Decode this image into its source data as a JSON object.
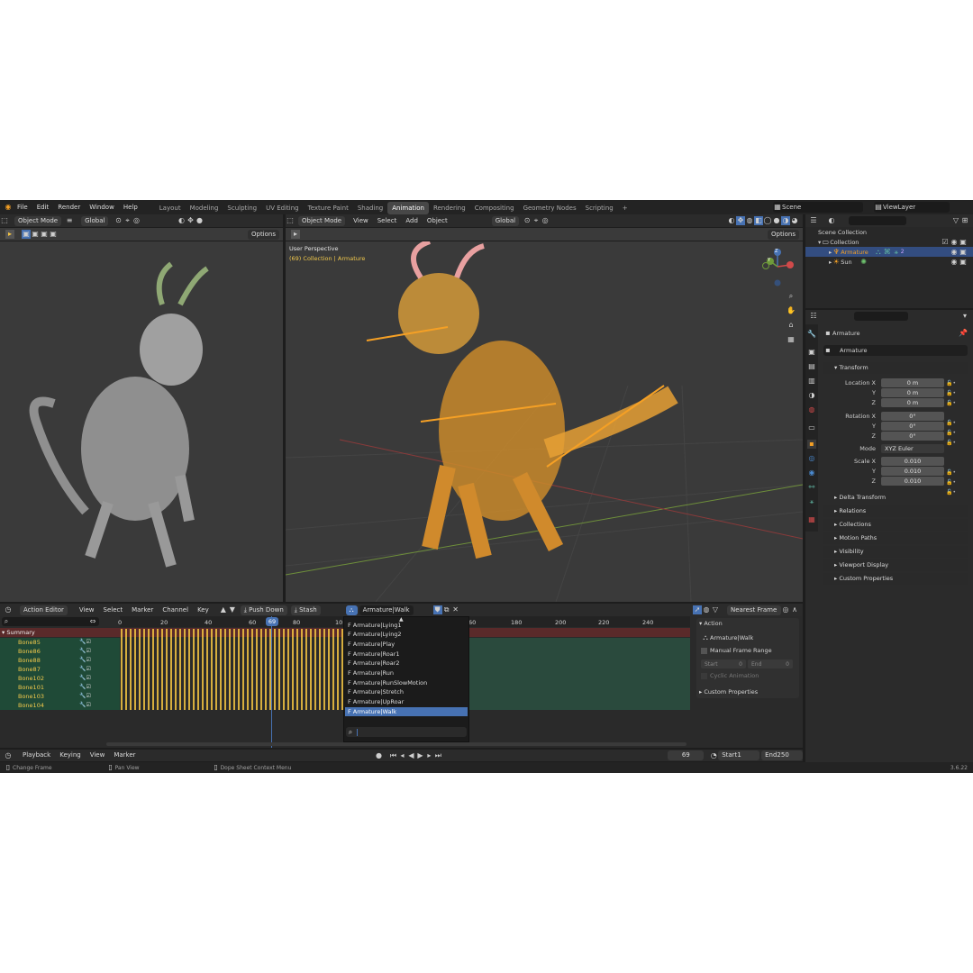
{
  "app": {
    "menu": [
      "File",
      "Edit",
      "Render",
      "Window",
      "Help"
    ],
    "workspaces": [
      "Layout",
      "Modeling",
      "Sculpting",
      "UV Editing",
      "Texture Paint",
      "Shading",
      "Animation",
      "Rendering",
      "Compositing",
      "Geometry Nodes",
      "Scripting"
    ],
    "active_workspace": "Animation",
    "add_tab": "+",
    "scene": "Scene",
    "view_layer": "ViewLayer",
    "version": "3.6.22"
  },
  "left_viewport": {
    "mode": "Object Mode",
    "orientation": "Global",
    "options": "Options"
  },
  "main_viewport": {
    "mode": "Object Mode",
    "menus": [
      "View",
      "Select",
      "Add",
      "Object"
    ],
    "orientation": "Global",
    "options": "Options",
    "perspective": "User Perspective",
    "context": "(69) Collection | Armature",
    "axes": {
      "z": "Z",
      "y": "Y"
    }
  },
  "outliner": {
    "root": "Scene Collection",
    "collection": "Collection",
    "items": [
      {
        "name": "Armature",
        "badge": "2"
      },
      {
        "name": "Sun"
      }
    ]
  },
  "properties": {
    "object_name": "Armature",
    "data_name": "Armature",
    "transform_header": "Transform",
    "location_label": "Location X",
    "y_label": "Y",
    "z_label": "Z",
    "location": [
      "0 m",
      "0 m",
      "0 m"
    ],
    "rotation_label": "Rotation X",
    "rotation": [
      "0°",
      "0°",
      "0°"
    ],
    "mode_label": "Mode",
    "mode_value": "XYZ Euler",
    "scale_label": "Scale X",
    "scale": [
      "0.010",
      "0.010",
      "0.010"
    ],
    "delta": "Delta Transform",
    "sections": [
      "Relations",
      "Collections",
      "Motion Paths",
      "Visibility",
      "Viewport Display",
      "Custom Properties"
    ]
  },
  "dopesheet": {
    "editor": "Action Editor",
    "menus": [
      "View",
      "Select",
      "Marker",
      "Channel",
      "Key"
    ],
    "push_down": "Push Down",
    "stash": "Stash",
    "action": "Armature|Walk",
    "snap": "Nearest Frame",
    "frame_ticks_left": [
      "0",
      "20",
      "40",
      "60",
      "80",
      "10"
    ],
    "frame_ticks_right": [
      "60",
      "180",
      "200",
      "220",
      "240"
    ],
    "current_frame": "69",
    "summary": "Summary",
    "channels": [
      "Bone85",
      "Bone86",
      "Bone88",
      "Bone87",
      "Bone102",
      "Bone101",
      "Bone103",
      "Bone104"
    ],
    "actions_list": [
      "F Armature|Lying1",
      "F Armature|Lying2",
      "F Armature|Play",
      "F Armature|Roar1",
      "F Armature|Roar2",
      "F Armature|Run",
      "F Armature|RunSlowMotion",
      "F Armature|Stretch",
      "F Armature|UpRoar",
      "F Armature|Walk"
    ],
    "side_panel": {
      "action_header": "Action",
      "action_name": "Armature|Walk",
      "manual_range": "Manual Frame Range",
      "start_label": "Start",
      "start_value": "0",
      "end_label": "End",
      "end_value": "0",
      "cyclic": "Cyclic Animation",
      "custom_props": "Custom Properties"
    }
  },
  "timeline": {
    "menus": [
      "Playback",
      "Keying",
      "View",
      "Marker"
    ],
    "frame": "69",
    "start_label": "Start",
    "start": "1",
    "end_label": "End",
    "end": "250"
  },
  "statusbar": {
    "items": [
      "Change Frame",
      "Pan View",
      "Dope Sheet Context Menu"
    ]
  },
  "colors": {
    "accent": "#4772b3",
    "selection_orange": "#f5a025",
    "channel_text": "#f2c94c"
  }
}
